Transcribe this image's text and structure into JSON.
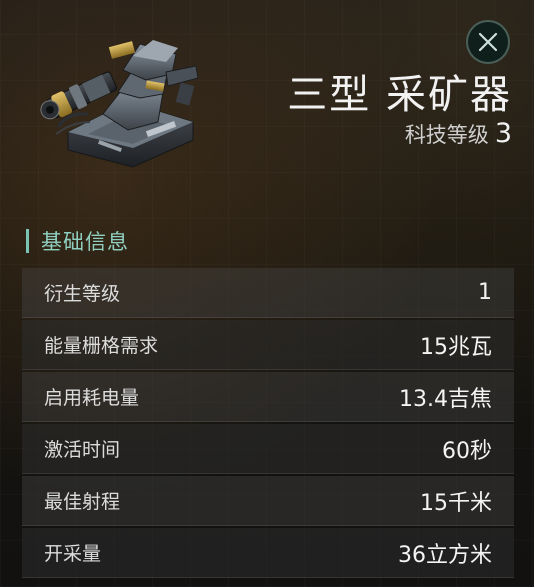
{
  "panel": {
    "title": "三型 采矿器",
    "tech_level_label": "科技等级",
    "tech_level_value": "3"
  },
  "section": {
    "title": "基础信息"
  },
  "stats": [
    {
      "label": "衍生等级",
      "value": "1"
    },
    {
      "label": "能量栅格需求",
      "value": "15兆瓦"
    },
    {
      "label": "启用耗电量",
      "value": "13.4吉焦"
    },
    {
      "label": "激活时间",
      "value": "60秒"
    },
    {
      "label": "最佳射程",
      "value": "15千米"
    },
    {
      "label": "开采量",
      "value": "36立方米"
    }
  ],
  "icons": {
    "close": "close-icon",
    "item": "mining-laser-module-image"
  },
  "colors": {
    "accent": "#8fd0c0",
    "background": "#17150f"
  }
}
